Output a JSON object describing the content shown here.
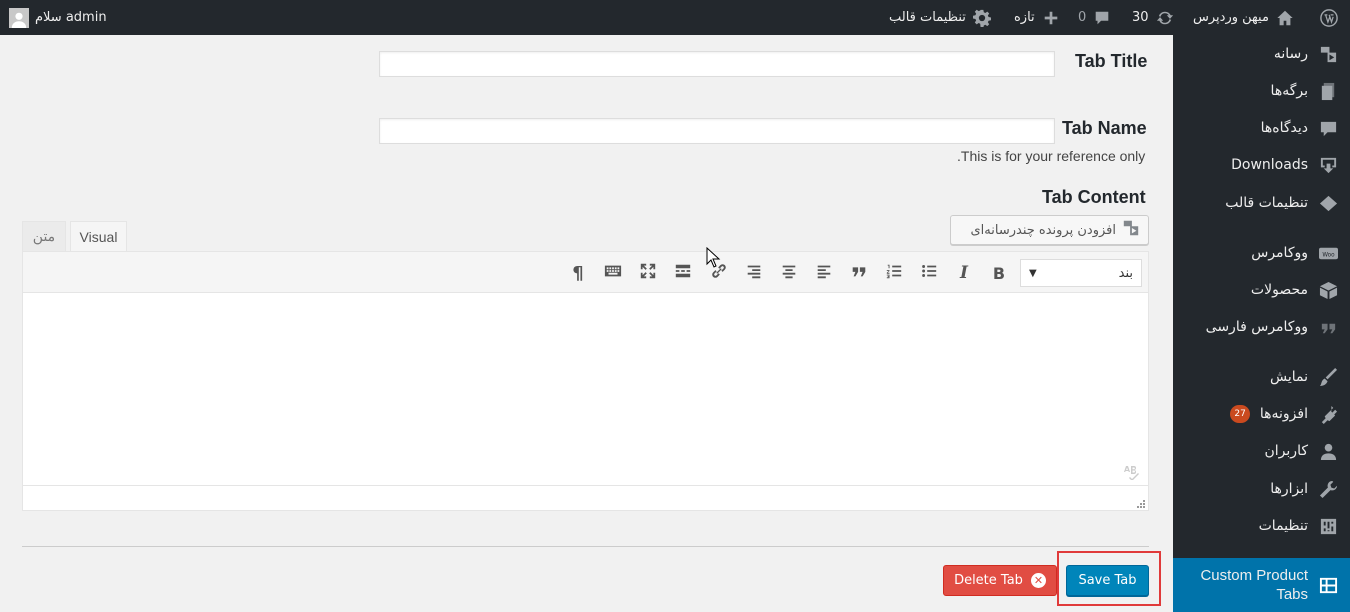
{
  "admin_bar": {
    "site_name": "میهن وردپرس",
    "updates_count": "30",
    "comments_count": "0",
    "new_label": "تازه",
    "theme_settings_label": "تنظیمات قالب",
    "greeting": "سلام admin"
  },
  "sidebar": {
    "items": [
      {
        "label": "رسانه",
        "icon": "media-icon"
      },
      {
        "label": "برگه‌ها",
        "icon": "pages-icon"
      },
      {
        "label": "دیدگاه‌ها",
        "icon": "comments-icon"
      },
      {
        "label": "Downloads",
        "icon": "download-icon"
      },
      {
        "label": "تنظیمات قالب",
        "icon": "diamond-icon"
      },
      {
        "label": "ووکامرس",
        "icon": "woo-icon"
      },
      {
        "label": "محصولات",
        "icon": "box-icon"
      },
      {
        "label": "ووکامرس فارسی",
        "icon": "quote-icon"
      },
      {
        "label": "نمایش",
        "icon": "brush-icon"
      },
      {
        "label": "افزونه‌ها",
        "icon": "plugin-icon",
        "badge": "27"
      },
      {
        "label": "کاربران",
        "icon": "user-icon"
      },
      {
        "label": "ابزارها",
        "icon": "wrench-icon"
      },
      {
        "label": "تنظیمات",
        "icon": "settings-icon"
      }
    ],
    "active": {
      "label_line1": "Custom Product",
      "label_line2": "Tabs",
      "icon": "grid-icon"
    }
  },
  "form": {
    "tab_title_label": "Tab Title",
    "tab_title_value": "",
    "tab_name_label": "Tab Name",
    "tab_name_value": "",
    "tab_name_help": ".This is for your reference only",
    "tab_content_label": "Tab Content"
  },
  "editor": {
    "add_media_label": "افزودن پرونده چندرسانه‌ای",
    "tab_visual": "Visual",
    "tab_text": "متن",
    "format_value": "بند",
    "content": ""
  },
  "actions": {
    "delete_label": "Delete Tab",
    "save_label": "Save Tab"
  },
  "colors": {
    "admin_dark": "#23282d",
    "active_blue": "#0073aa",
    "primary_button": "#0085ba",
    "delete_button": "#e14d43",
    "highlight": "#e03a3a",
    "badge": "#ca4a1f"
  }
}
